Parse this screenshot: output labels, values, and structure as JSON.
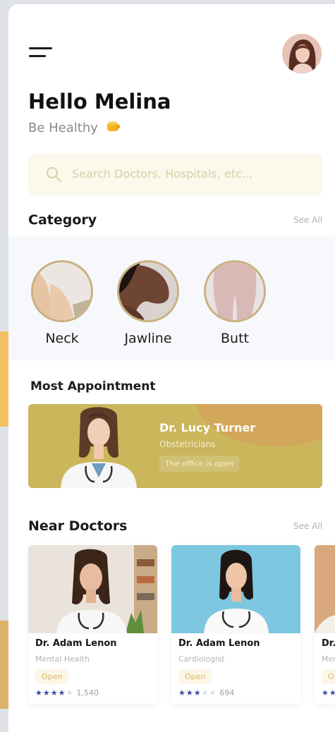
{
  "header": {
    "greeting": "Hello Melina",
    "subgreeting": "Be Healthy"
  },
  "search": {
    "placeholder": "Search Doctors, Hospitals, etc..."
  },
  "category": {
    "title": "Category",
    "see_all": "See All",
    "items": [
      {
        "label": "Neck"
      },
      {
        "label": "Jawline"
      },
      {
        "label": "Butt"
      }
    ]
  },
  "most_appointment": {
    "title": "Most Appointment",
    "doctor": {
      "name": "Dr. Lucy Turner",
      "specialty": "Obstetricians",
      "status": "The office is open"
    }
  },
  "near_doctors": {
    "title": "Near Doctors",
    "see_all": "See All",
    "cards": [
      {
        "name": "Dr. Adam Lenon",
        "specialty": "Mental Health",
        "status": "Open",
        "rating": 4,
        "reviews": "1,540"
      },
      {
        "name": "Dr. Adam Lenon",
        "specialty": "Cardiologist",
        "status": "Open",
        "rating": 3,
        "reviews": "694"
      },
      {
        "name": "Dr.",
        "specialty": "Men",
        "status": "O",
        "rating": 2,
        "reviews": ""
      }
    ]
  },
  "colors": {
    "accent": "#cbb65c",
    "background": "#ffffff",
    "search_bg": "#fbf8ec",
    "star": "#3c4d9e",
    "category_border": "#c9b07e"
  }
}
